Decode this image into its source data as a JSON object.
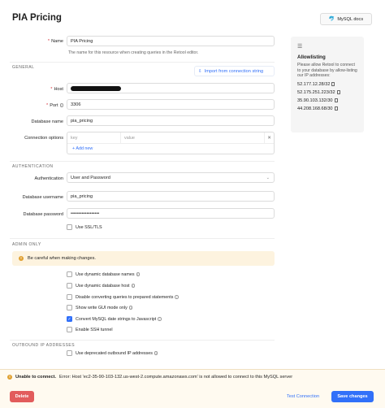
{
  "header": {
    "title": "PIA Pricing",
    "docs_label": "MySQL docs",
    "docs_icon": "dolphin-icon"
  },
  "fields": {
    "name": {
      "label": "Name",
      "value": "PIA Pricing",
      "hint": "The name for this resource when creating queries in the Retool editor."
    },
    "general_section": "GENERAL",
    "import_label": "Import from connection string",
    "host": {
      "label": "Host"
    },
    "port": {
      "label": "Port",
      "value": "3306"
    },
    "database_name": {
      "label": "Database name",
      "value": "pia_pricing"
    },
    "connection_options": {
      "label": "Connection options",
      "key_placeholder": "key",
      "value_placeholder": "value",
      "add_label": "+ Add new"
    },
    "auth_section": "AUTHENTICATION",
    "authentication": {
      "label": "Authentication",
      "value": "User and Password"
    },
    "db_username": {
      "label": "Database username",
      "value": "pia_pricing"
    },
    "db_password": {
      "label": "Database password",
      "value": "••••••••••••••••••"
    },
    "ssl": {
      "label": "Use SSL/TLS",
      "checked": false
    }
  },
  "admin": {
    "section": "ADMIN ONLY",
    "warning": "Be careful when making changes.",
    "options": [
      {
        "label": "Use dynamic database names",
        "checked": false,
        "info": true
      },
      {
        "label": "Use dynamic database host",
        "checked": false,
        "info": true
      },
      {
        "label": "Disable converting queries to prepared statements",
        "checked": false,
        "info": true
      },
      {
        "label": "Show write GUI mode only",
        "checked": false,
        "info": true
      },
      {
        "label": "Convert MySQL date strings to Javascript",
        "checked": true,
        "info": true
      },
      {
        "label": "Enable SSH tunnel",
        "checked": false,
        "info": false
      }
    ]
  },
  "outbound": {
    "section": "OUTBOUND IP ADDRESSES",
    "option": {
      "label": "Use deprecated outbound IP addresses",
      "checked": false
    }
  },
  "allowlist": {
    "title": "Allowlisting",
    "text": "Please allow Retool to connect to your database by allow-listing our IP addresses:",
    "ips": [
      "52.177.12.28/32",
      "52.175.251.223/32",
      "35.90.103.132/30",
      "44.208.168.68/30"
    ]
  },
  "footer": {
    "error_bold": "Unable to connect.",
    "error_text": "Error: Host 'ec2-35-90-103-132.us-west-2.compute.amazonaws.com' is not allowed to connect to this MySQL server",
    "delete_label": "Delete",
    "test_label": "Test Connection",
    "save_label": "Save changes"
  },
  "colors": {
    "primary": "#3170f9",
    "danger": "#e25c5c",
    "warning_bg": "#fdf3df"
  }
}
